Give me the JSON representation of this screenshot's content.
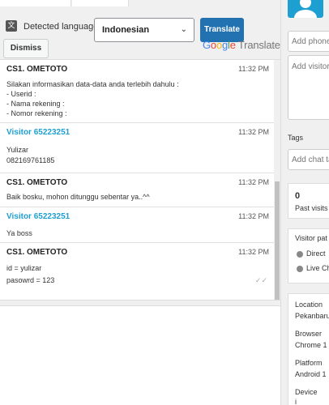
{
  "toolbar": {
    "detected_label": "Detected language",
    "language_value": "Indonesian",
    "translate_label": "Translate",
    "dismiss_label": "Dismiss",
    "google": {
      "G": "G",
      "o1": "o",
      "o2": "o",
      "g": "g",
      "l": "l",
      "e": "e",
      "rest": " Translate"
    }
  },
  "messages": [
    {
      "sender": "CS1. OMETOTO",
      "role": "agent",
      "time": "11:32 PM",
      "lines": [
        "Silakan informasikan data-data anda terlebih dahulu :",
        "- Userid :",
        "- Nama rekening :",
        "- Nomor rekening :"
      ]
    },
    {
      "sender": "Visitor 65223251",
      "role": "visitor",
      "time": "11:32 PM",
      "lines": [
        "Yulizar",
        "082169761185"
      ]
    },
    {
      "sender": "CS1. OMETOTO",
      "role": "agent",
      "time": "11:32 PM",
      "lines": [
        "Baik bosku, mohon ditunggu sebentar ya..^^"
      ]
    },
    {
      "sender": "Visitor 65223251",
      "role": "visitor",
      "time": "11:32 PM",
      "lines": [
        "Ya boss"
      ]
    },
    {
      "sender": "CS1. OMETOTO",
      "role": "agent",
      "time": "11:32 PM",
      "lines": [
        "id = yulizar",
        "pasowrd = 123"
      ]
    }
  ],
  "sidebar": {
    "phone_placeholder": "Add phone",
    "notes_placeholder": "Add visitor",
    "tags_label": "Tags",
    "tag_placeholder": "Add chat ta",
    "past_visits_count": "0",
    "past_visits_label": "Past visits",
    "visitor_path_label": "Visitor pat",
    "path_items": [
      "Direct",
      "Live Ch"
    ],
    "location_label": "Location",
    "location_value": "Pekanbaru",
    "browser_label": "Browser",
    "browser_value": "Chrome 1",
    "platform_label": "Platform",
    "platform_value": "Android 1",
    "device_label": "Device",
    "device_value": "i"
  },
  "colors": {
    "accent": "#2271b1",
    "visitor": "#1e9fd1"
  }
}
